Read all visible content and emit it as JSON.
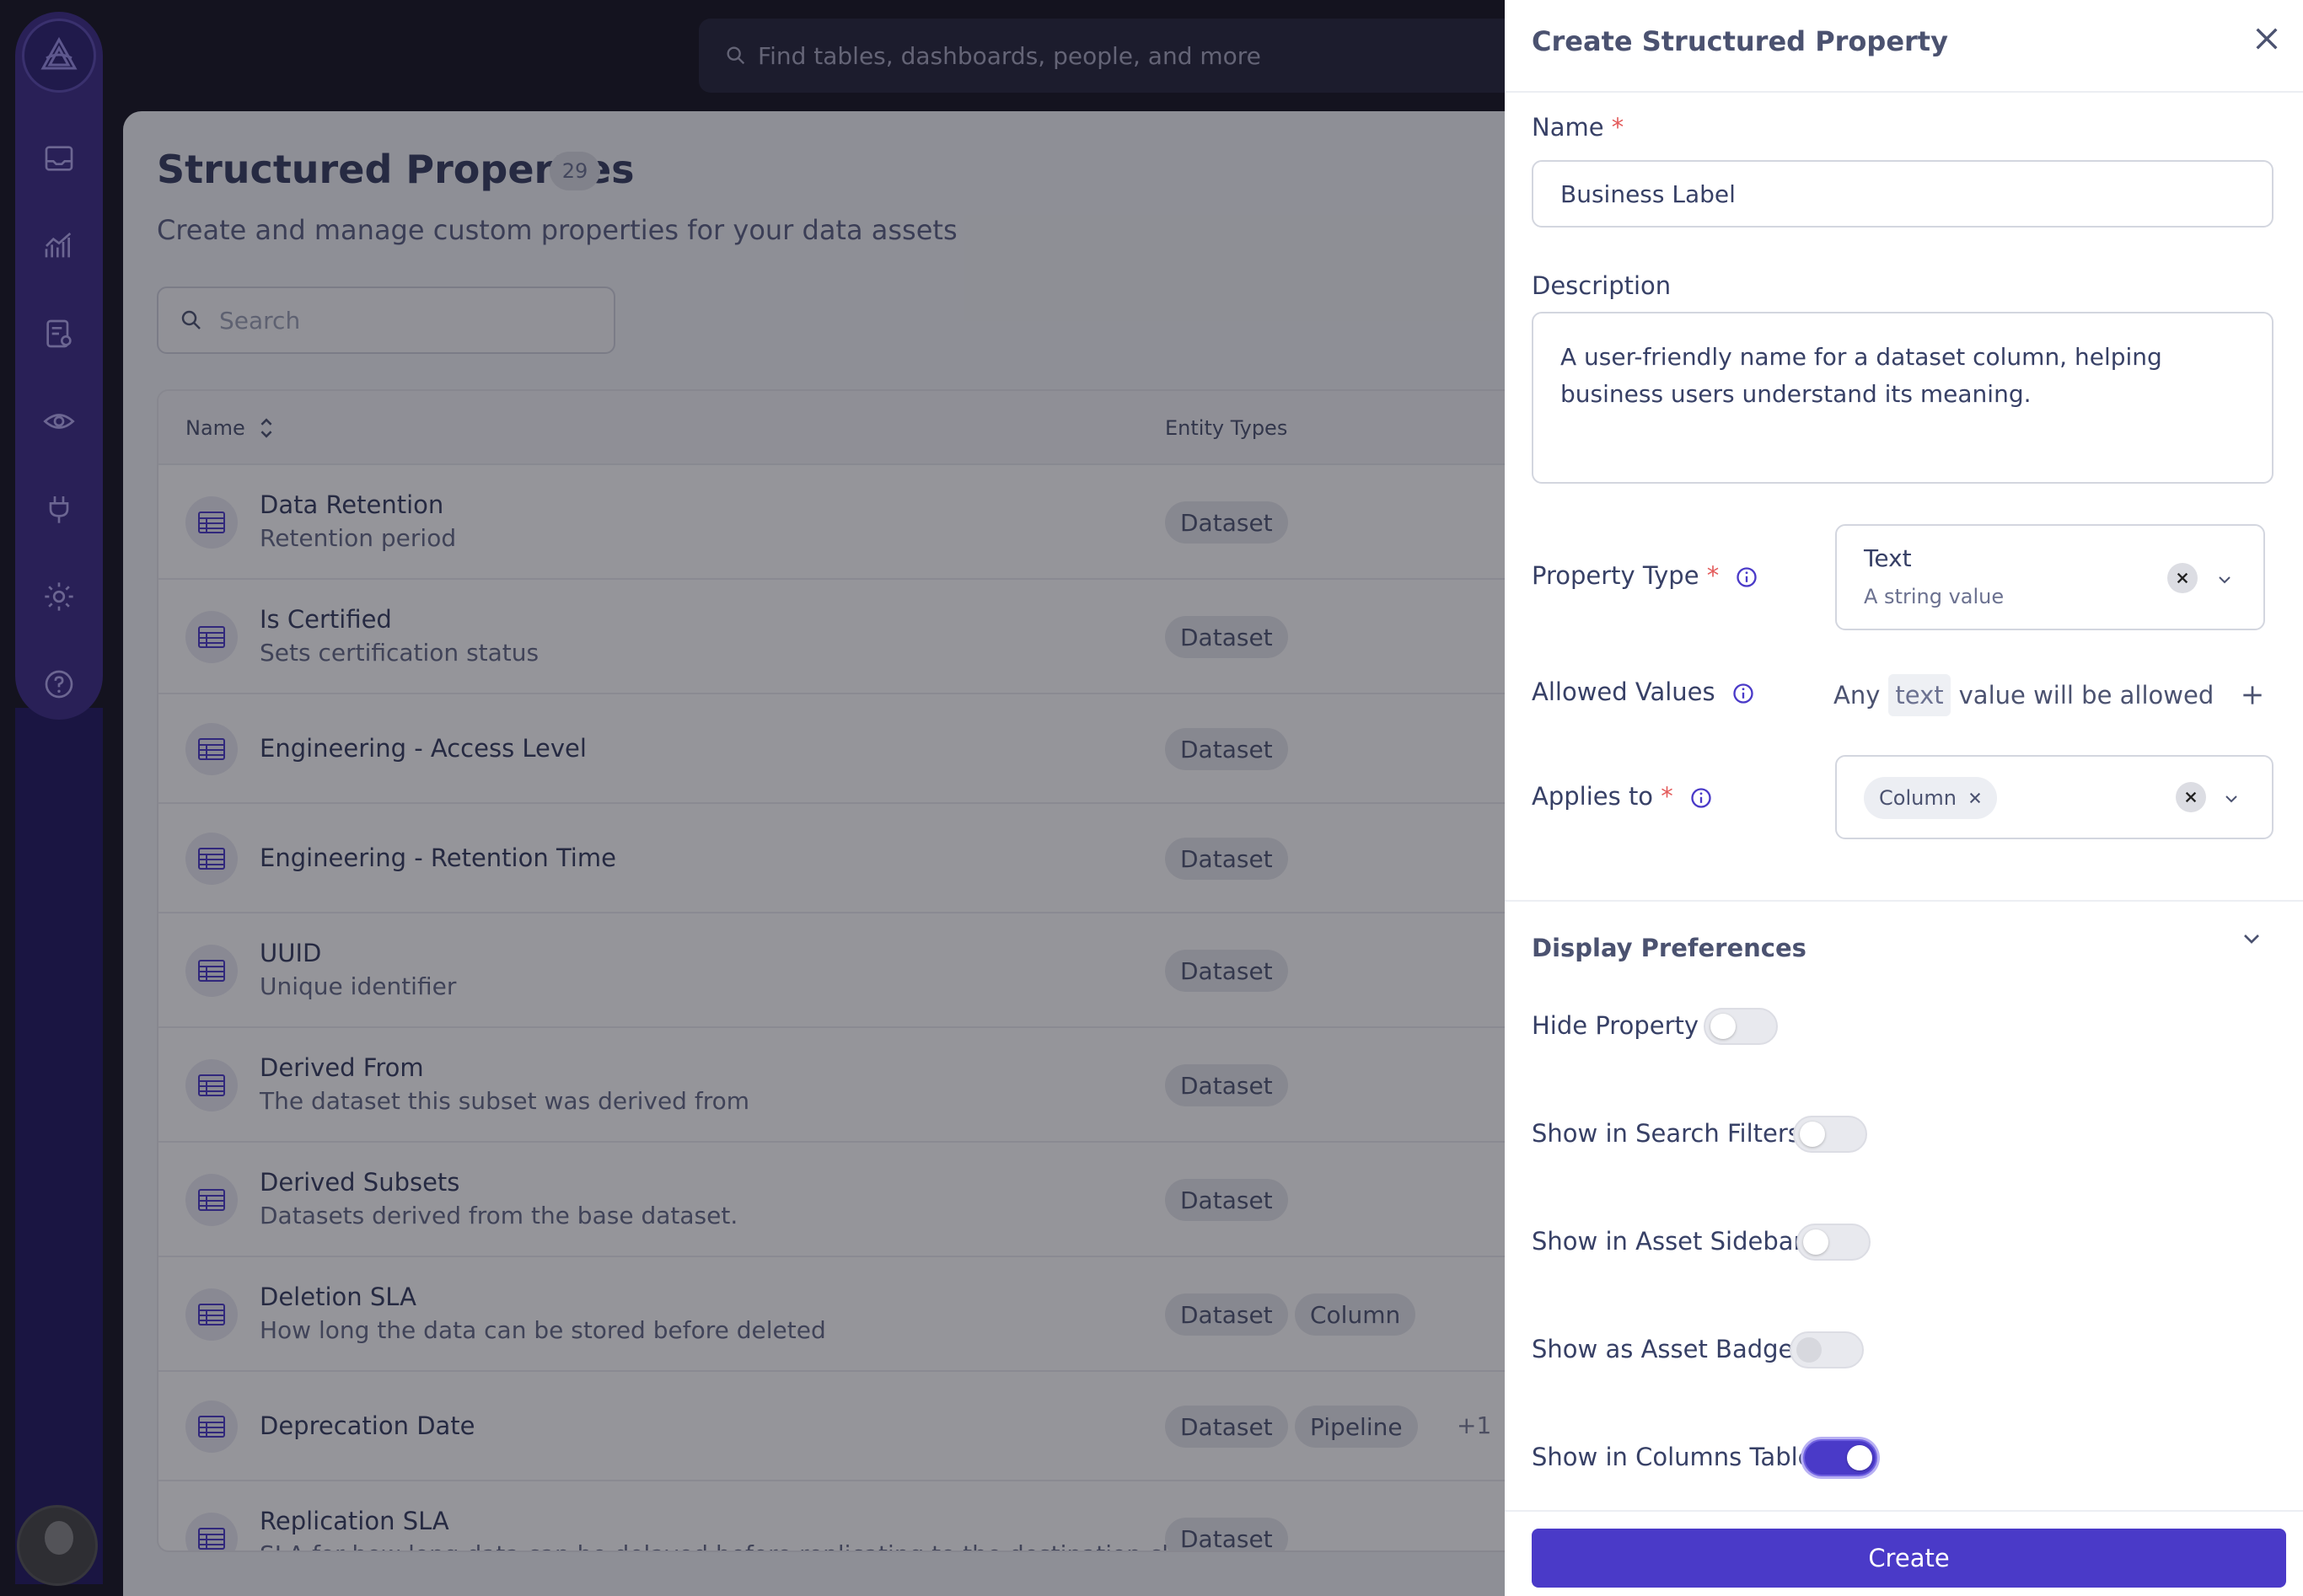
{
  "topbar": {
    "search_placeholder": "Find tables, dashboards, people, and more"
  },
  "sidebar": {
    "items": [
      {
        "icon": "inbox-icon"
      },
      {
        "icon": "analytics-icon"
      },
      {
        "icon": "governance-icon"
      },
      {
        "icon": "observe-icon"
      },
      {
        "icon": "plug-icon"
      },
      {
        "icon": "gear-icon"
      },
      {
        "icon": "help-icon"
      }
    ]
  },
  "main": {
    "title": "Structured Properties",
    "count": "29",
    "subtitle": "Create and manage custom properties for your data assets",
    "search_placeholder": "Search",
    "columns": {
      "name": "Name",
      "entity_types": "Entity Types"
    },
    "rows": [
      {
        "name": "Data Retention",
        "desc": "Retention period",
        "tags": [
          "Dataset"
        ]
      },
      {
        "name": "Is Certified",
        "desc": "Sets certification status",
        "tags": [
          "Dataset"
        ]
      },
      {
        "name": "Engineering - Access Level",
        "desc": "",
        "tags": [
          "Dataset"
        ]
      },
      {
        "name": "Engineering - Retention Time",
        "desc": "",
        "tags": [
          "Dataset"
        ]
      },
      {
        "name": "UUID",
        "desc": "Unique identifier",
        "tags": [
          "Dataset"
        ]
      },
      {
        "name": "Derived From",
        "desc": "The dataset this subset was derived from",
        "tags": [
          "Dataset"
        ]
      },
      {
        "name": "Derived Subsets",
        "desc": "Datasets derived from the base dataset.",
        "tags": [
          "Dataset"
        ]
      },
      {
        "name": "Deletion SLA",
        "desc": "How long the data can be stored before deleted",
        "tags": [
          "Dataset",
          "Column"
        ]
      },
      {
        "name": "Deprecation Date",
        "desc": "",
        "tags": [
          "Dataset",
          "Pipeline"
        ],
        "more": "+1"
      },
      {
        "name": "Replication SLA",
        "desc": "SLA for how long data can be delayed before replicating to the destination cl",
        "tags": [
          "Dataset"
        ]
      }
    ]
  },
  "drawer": {
    "title": "Create Structured Property",
    "name_label": "Name",
    "name_value": "Business Label",
    "description_label": "Description",
    "description_value": "A user-friendly name for a dataset column, helping business users understand its meaning.",
    "property_type_label": "Property Type",
    "property_type_value": "Text",
    "property_type_sub": "A string value",
    "allowed_values_label": "Allowed Values",
    "allowed_any": "Any",
    "allowed_code": "text",
    "allowed_rest": "value will be allowed",
    "applies_to_label": "Applies to",
    "applies_to_chip": "Column",
    "display_prefs_title": "Display Preferences",
    "toggles": [
      {
        "label": "Hide Property",
        "on": false
      },
      {
        "label": "Show in Search Filters",
        "on": false
      },
      {
        "label": "Show in Asset Sidebar",
        "on": false
      },
      {
        "label": "Show as Asset Badge",
        "on": false
      },
      {
        "label": "Show in Columns Table",
        "on": true
      }
    ],
    "create_label": "Create",
    "required_mark": "*"
  },
  "colors": {
    "accent": "#4a3ac8",
    "sidebar": "#3b2b86",
    "topbar": "#14131f"
  }
}
